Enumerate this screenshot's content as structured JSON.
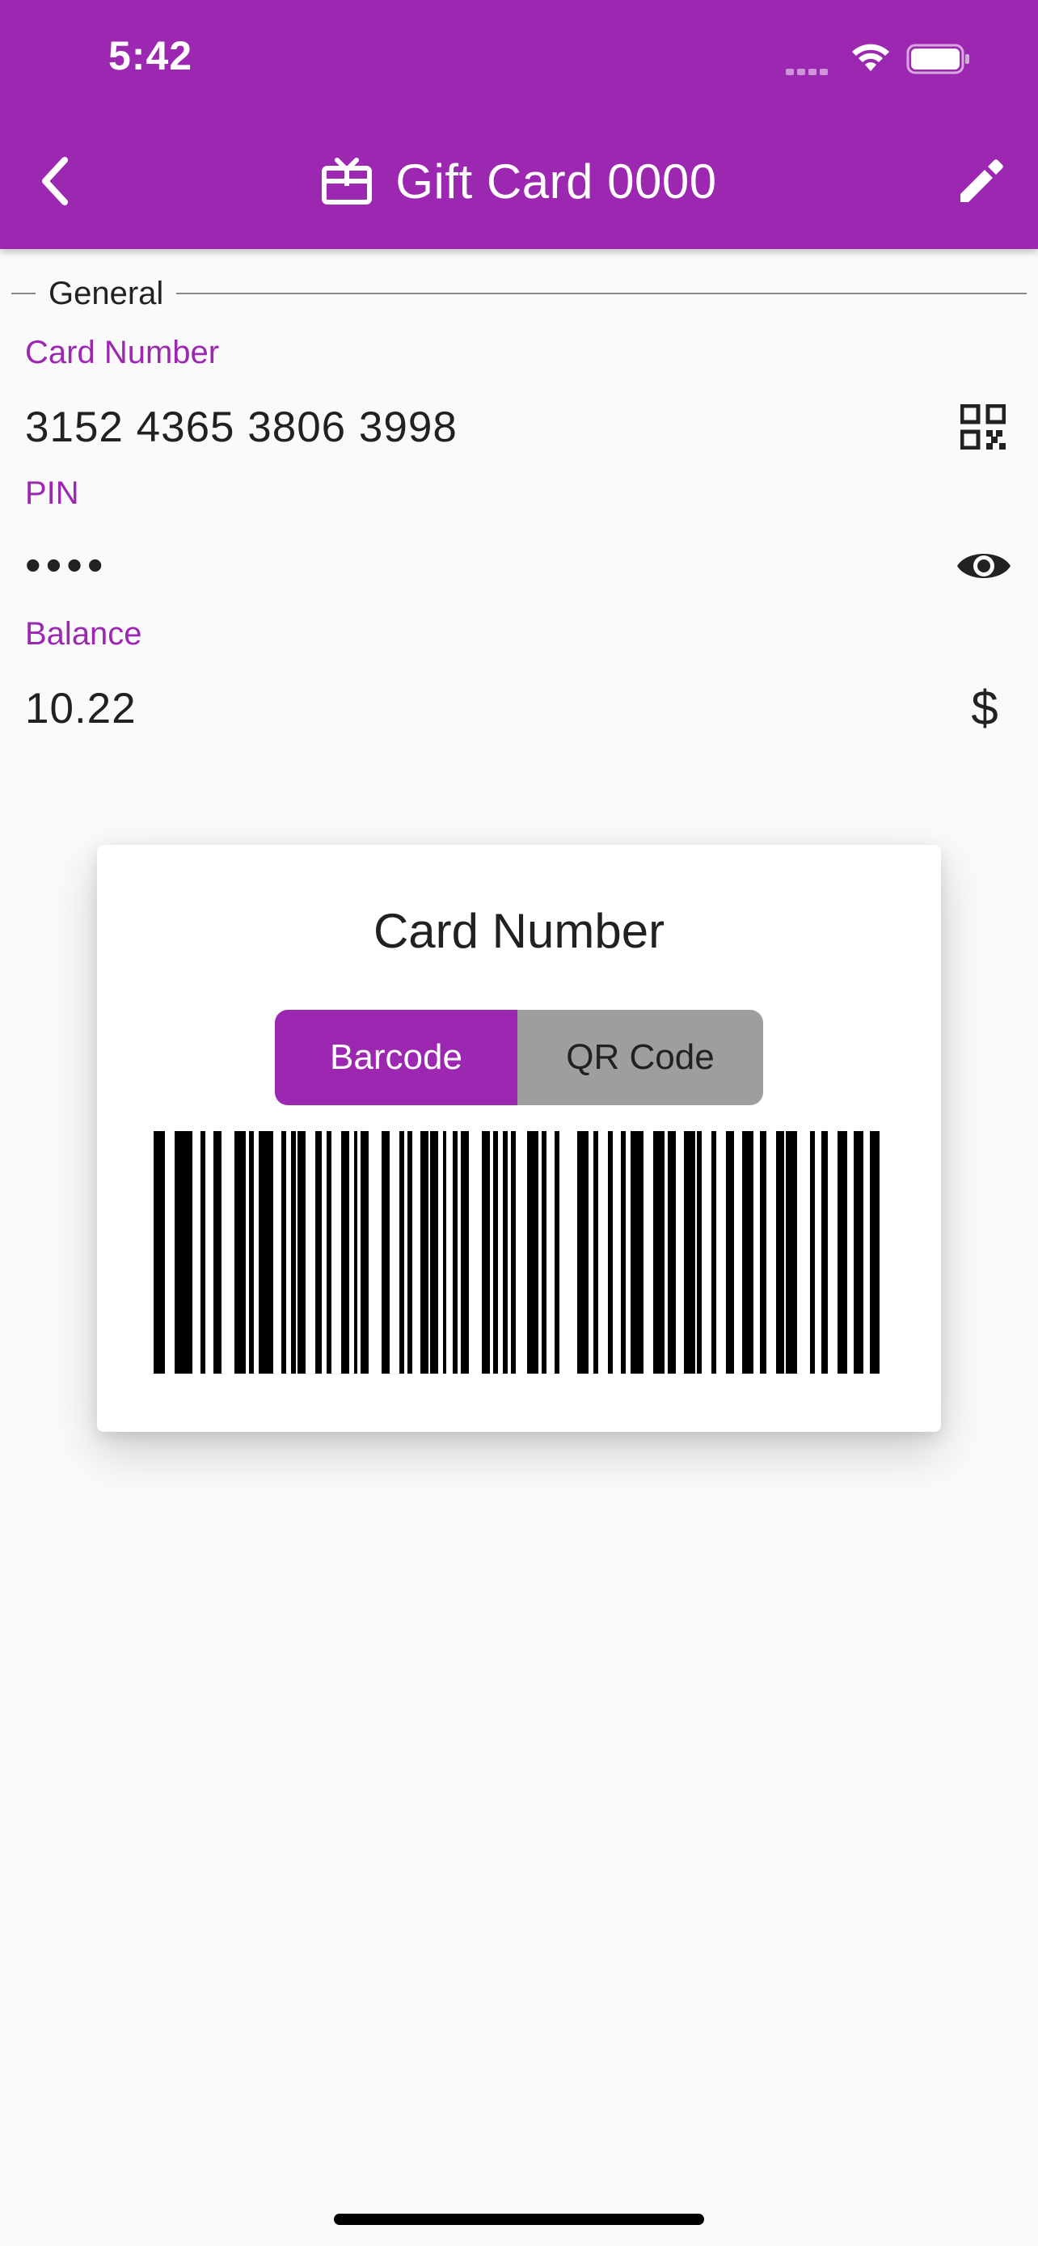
{
  "status_bar": {
    "time": "5:42"
  },
  "header": {
    "title": "Gift Card 0000",
    "back_icon": "chevron-left-icon",
    "title_icon": "gift-card-icon",
    "edit_icon": "pencil-icon"
  },
  "section": {
    "label": "General"
  },
  "fields": {
    "card_number": {
      "label": "Card Number",
      "value": "3152 4365 3806 3998",
      "icon": "qr-code-icon"
    },
    "pin": {
      "label": "PIN",
      "value": "••••",
      "icon": "eye-icon"
    },
    "balance": {
      "label": "Balance",
      "value": "10.22",
      "icon": "$"
    }
  },
  "dialog": {
    "title": "Card Number",
    "segments": {
      "barcode_label": "Barcode",
      "qr_label": "QR Code",
      "selected": "Barcode"
    }
  },
  "colors": {
    "primary": "#9c27b0",
    "segment_inactive": "#9e9e9e",
    "background": "#fafafa"
  }
}
